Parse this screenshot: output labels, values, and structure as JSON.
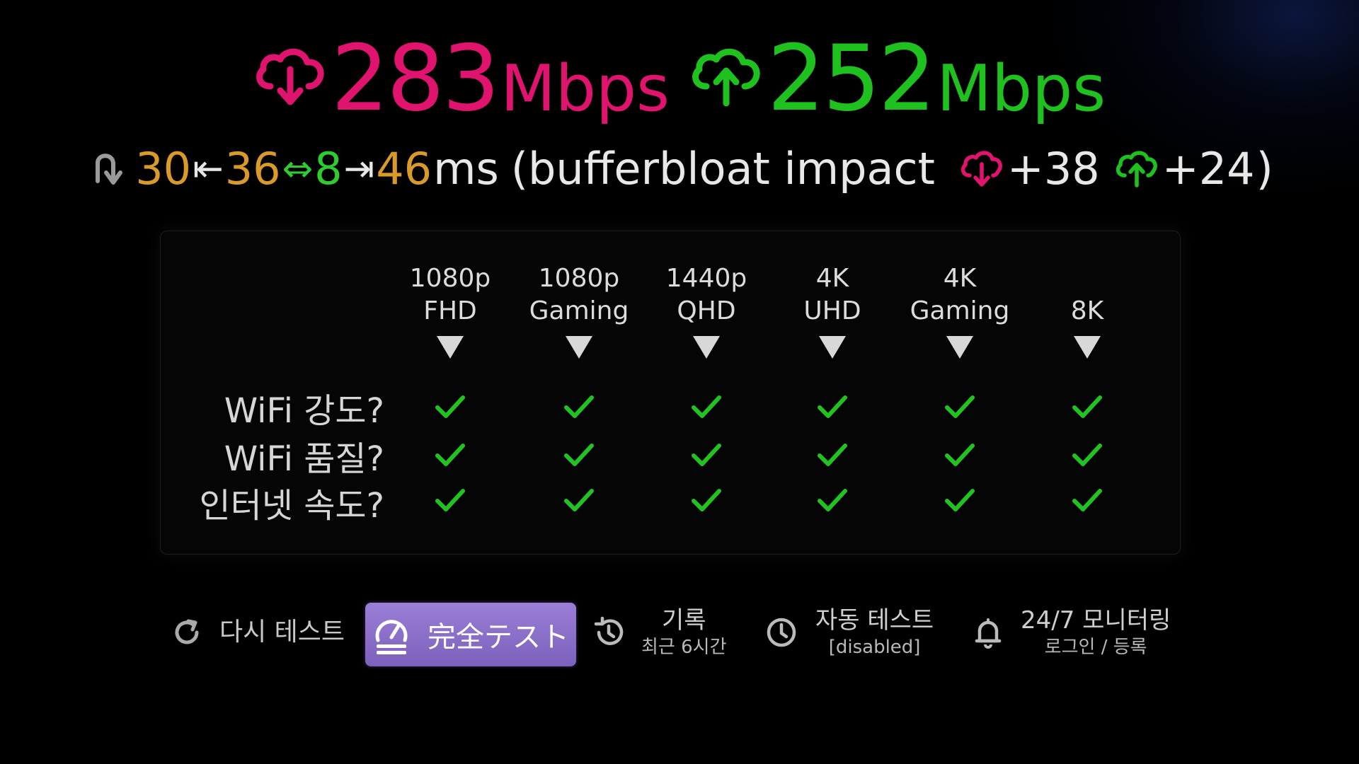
{
  "colors": {
    "download": "#e0146e",
    "upload": "#1fc11f",
    "latency_orange": "#d99a2a",
    "latency_green": "#2ecc2e",
    "text_light": "#e8e8e8",
    "check_green": "#22c222",
    "button_purple": "#8a6fcb"
  },
  "speed": {
    "download": {
      "value": "283",
      "unit": "Mbps",
      "icon": "cloud-download-icon"
    },
    "upload": {
      "value": "252",
      "unit": "Mbps",
      "icon": "cloud-upload-icon"
    }
  },
  "latency": {
    "icon": "latency-icon",
    "min": "30",
    "min_arrow": "⇤",
    "idle": "36",
    "jitter_arrow": "⇔",
    "jitter": "8",
    "max_arrow": "⇥",
    "max": "46",
    "unit": "ms",
    "bufferbloat_label": "(bufferbloat impact",
    "download_impact": "+38",
    "upload_impact": "+24",
    "close_paren": ")"
  },
  "quality_table": {
    "columns": [
      {
        "line1": "1080p",
        "line2": "FHD"
      },
      {
        "line1": "1080p",
        "line2": "Gaming"
      },
      {
        "line1": "1440p",
        "line2": "QHD"
      },
      {
        "line1": "4K",
        "line2": "UHD"
      },
      {
        "line1": "4K",
        "line2": "Gaming"
      },
      {
        "line1": "",
        "line2": "8K"
      }
    ],
    "rows": [
      {
        "label": "WiFi 강도?",
        "checks": [
          true,
          true,
          true,
          true,
          true,
          true
        ]
      },
      {
        "label": "WiFi 품질?",
        "checks": [
          true,
          true,
          true,
          true,
          true,
          true
        ]
      },
      {
        "label": "인터넷 속도?",
        "checks": [
          true,
          true,
          true,
          true,
          true,
          true
        ]
      }
    ]
  },
  "bottom_bar": {
    "retest": {
      "label": "다시 테스트",
      "icon": "refresh-icon"
    },
    "full_test": {
      "label": "完全テスト",
      "icon": "speedometer-icon"
    },
    "history": {
      "title": "기록",
      "subtitle": "최근 6시간",
      "icon": "history-icon"
    },
    "auto_test": {
      "title": "자동 테스트",
      "subtitle": "[disabled]",
      "icon": "clock-icon"
    },
    "monitoring": {
      "title": "24/7 모니터링",
      "subtitle": "로그인 / 등록",
      "icon": "bell-icon"
    }
  }
}
